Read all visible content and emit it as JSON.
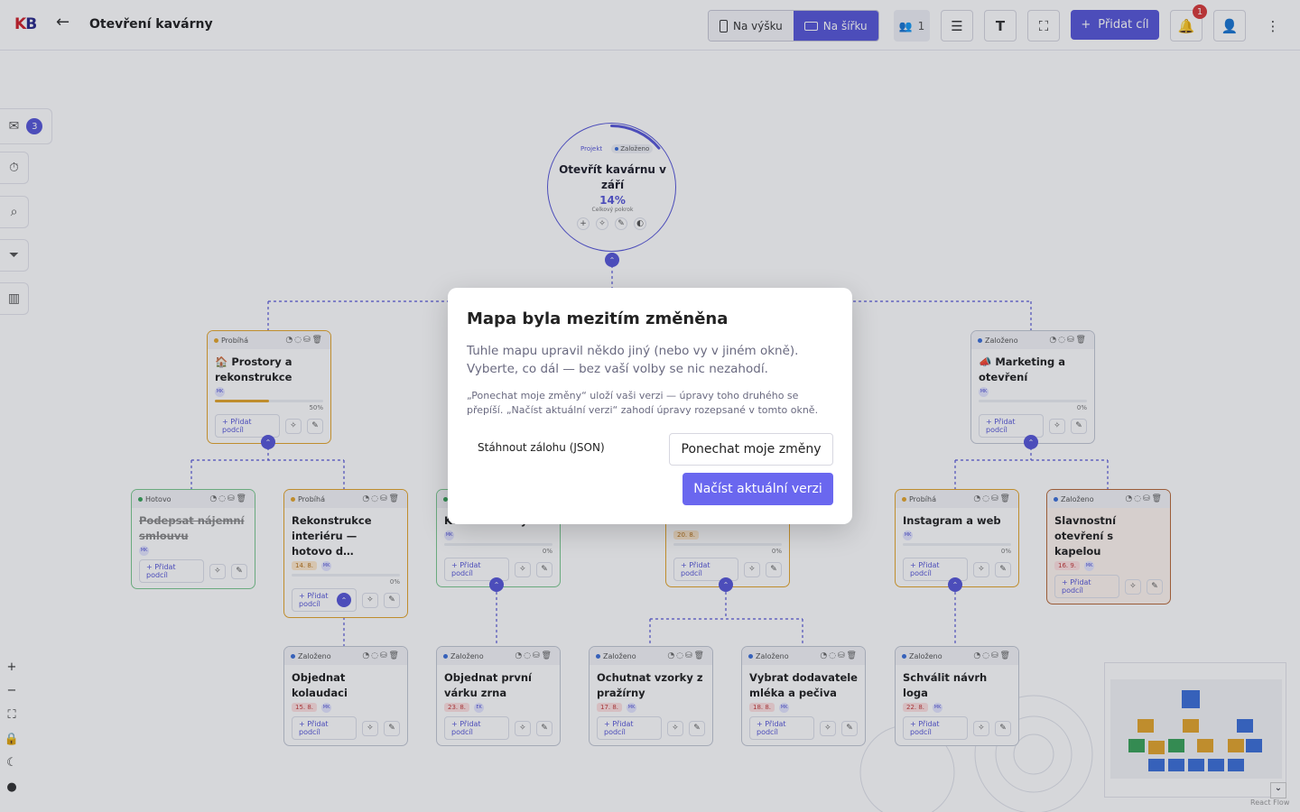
{
  "header": {
    "logo": {
      "first": "K",
      "second": "B"
    },
    "title": "Otevření kavárny",
    "view_portrait": "Na výšku",
    "view_landscape": "Na šířku",
    "users_count": "1",
    "add_goal": "Přidat cíl",
    "notifications_count": "1",
    "icons": {
      "back": "arrow-left-icon",
      "users": "users-icon",
      "layout": "rows-icon",
      "text": "text-icon",
      "fullscreen": "fullscreen-icon",
      "bell": "bell-icon",
      "user": "user-icon",
      "more": "more-vertical-icon"
    }
  },
  "sidebar": {
    "inbox_count": "3",
    "icons": [
      "inbox-icon",
      "timer-icon",
      "search-icon",
      "filter-icon",
      "chart-icon"
    ]
  },
  "root": {
    "tag": "Projekt",
    "status": "Založeno",
    "title": "Otevřít kavárnu v září",
    "percent": "14%",
    "percent_value": 0.14,
    "caption": "Celkový pokrok"
  },
  "cards": [
    {
      "id": "c1",
      "status": "Probíhá",
      "status_color": "#e3a52c",
      "title": "🏠 Prostory a rekonstrukce",
      "avatar": "MK",
      "progress": 0.5,
      "percent": "50%",
      "add": "Přidat podcíl"
    },
    {
      "id": "c2",
      "status": "Založeno",
      "status_color": "#3c6fd8",
      "title": "📣 Marketing a otevření",
      "avatar": "MK",
      "progress": 0,
      "percent": "0%",
      "add": "Přidat podcíl"
    },
    {
      "id": "c3",
      "status": "Hotovo",
      "status_color": "#3aa35a",
      "title": "Podepsat nájemní smlouvu",
      "avatar": "MK",
      "add": "Přidat podcíl"
    },
    {
      "id": "c4",
      "status": "Probíhá",
      "status_color": "#e3a52c",
      "title": "Rekonstrukce interiéru — hotovo d…",
      "date": "14. 8.",
      "avatar": "MK",
      "progress": 0,
      "percent": "0%",
      "add": "Přidat podcíl"
    },
    {
      "id": "c5",
      "status": "Hotovo",
      "status_color": "#3aa35a",
      "title": "Kávovar a mlýnek",
      "avatar": "MK",
      "progress": 0,
      "percent": "0%",
      "add": "Přidat podcíl"
    },
    {
      "id": "c6",
      "status": "Probíhá",
      "status_color": "#e3a52c",
      "title": "Menu a ceník",
      "date": "20. 8.",
      "progress": 0,
      "percent": "0%",
      "add": "Přidat podcíl"
    },
    {
      "id": "c7",
      "status": "Probíhá",
      "status_color": "#e3a52c",
      "title": "Instagram a web",
      "avatar": "MK",
      "progress": 0,
      "percent": "0%",
      "add": "Přidat podcíl"
    },
    {
      "id": "c8",
      "status": "Založeno",
      "status_color": "#3c6fd8",
      "title": "Slavnostní otevření s kapelou",
      "date": "16. 9.",
      "avatar": "MK",
      "add": "Přidat podcíl"
    },
    {
      "id": "c9",
      "status": "Založeno",
      "status_color": "#3c6fd8",
      "title": "Objednat kolaudaci",
      "date": "15. 8.",
      "avatar": "MK",
      "add": "Přidat podcíl"
    },
    {
      "id": "c10",
      "status": "Založeno",
      "status_color": "#3c6fd8",
      "title": "Objednat první várku zrna",
      "date": "23. 8.",
      "avatar": "EK",
      "add": "Přidat podcíl"
    },
    {
      "id": "c11",
      "status": "Založeno",
      "status_color": "#3c6fd8",
      "title": "Ochutnat vzorky z pražírny",
      "date": "17. 8.",
      "avatar": "MK",
      "add": "Přidat podcíl"
    },
    {
      "id": "c12",
      "status": "Založeno",
      "status_color": "#3c6fd8",
      "title": "Vybrat dodavatele mléka a pečiva",
      "date": "18. 8.",
      "avatar": "MK",
      "add": "Přidat podcíl"
    },
    {
      "id": "c13",
      "status": "Založeno",
      "status_color": "#3c6fd8",
      "title": "Schválit návrh loga",
      "date": "22. 8.",
      "avatar": "MK",
      "add": "Přidat podcíl"
    }
  ],
  "footer": {
    "attribution": "React Flow"
  },
  "modal": {
    "title": "Mapa byla mezitím změněna",
    "description": "Tuhle mapu upravil někdo jiný (nebo vy v jiném okně). Vyberte, co dál — bez vaší volby se nic nezahodí.",
    "note": "„Ponechat moje změny“ uloží vaši verzi — úpravy toho druhého se přepíší. „Načíst aktuální verzi“ zahodí úpravy rozepsané v tomto okně.",
    "download": "Stáhnout zálohu (JSON)",
    "keep": "Ponechat moje změny",
    "load": "Načíst aktuální verzi"
  }
}
